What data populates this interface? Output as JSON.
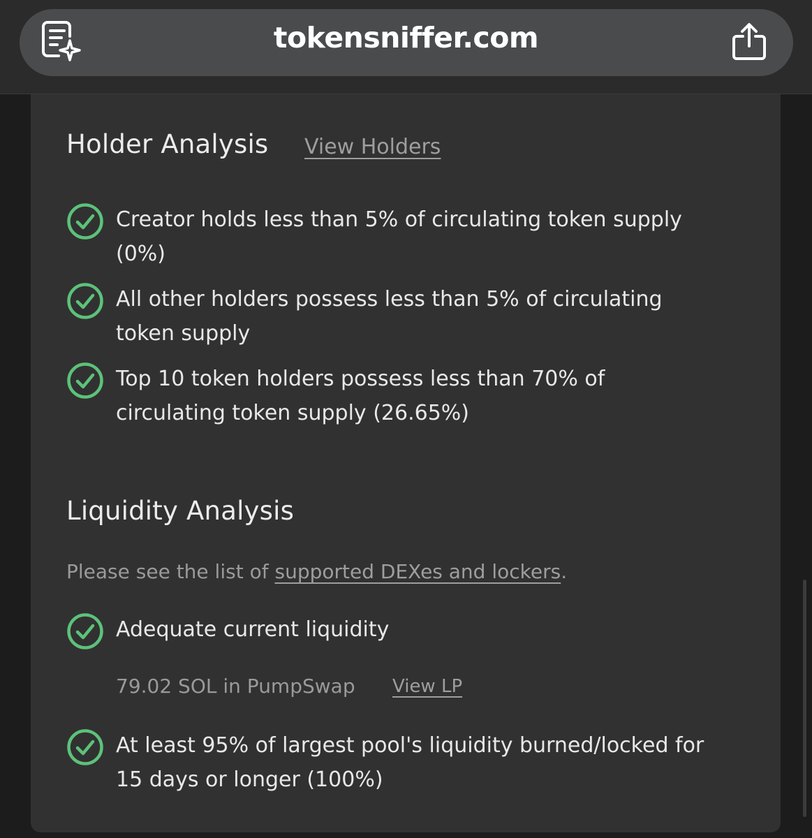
{
  "browser": {
    "url": "tokensniffer.com",
    "reader_icon": "reader-mode-icon",
    "share_icon": "share-icon"
  },
  "holder": {
    "title": "Holder Analysis",
    "view_link": "View Holders",
    "checks": [
      {
        "line1": "Creator holds less than 5% of circulating token supply",
        "line2": "(0%)"
      },
      {
        "line1": "All other holders possess less than 5% of circulating",
        "line2": "token supply"
      },
      {
        "line1": "Top 10 token holders possess less than 70% of",
        "line2": "circulating token supply (26.65%)"
      }
    ]
  },
  "liquidity": {
    "title": "Liquidity Analysis",
    "note_prefix": "Please see the list of ",
    "note_link": "supported DEXes and lockers",
    "note_suffix": ".",
    "checks": [
      {
        "line1": "Adequate current liquidity"
      },
      {
        "line1": "At least 95% of largest pool's liquidity burned/locked for",
        "line2": "15 days or longer (100%)"
      }
    ],
    "pool_text": "79.02 SOL in PumpSwap",
    "pool_link": "View LP"
  },
  "colors": {
    "check_green": "#5cc27a",
    "card_bg": "#313131",
    "urlbar_bg": "#4a4b4d"
  }
}
